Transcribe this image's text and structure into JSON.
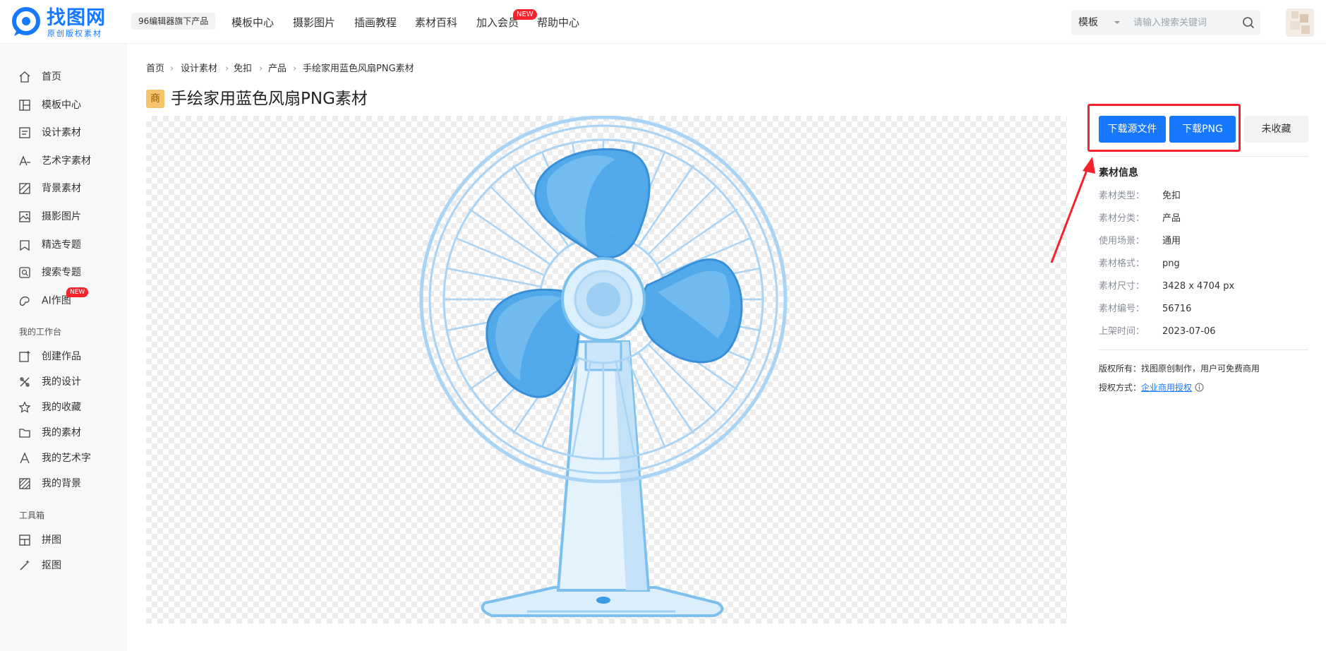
{
  "header": {
    "logo_title": "找图网",
    "logo_sub": "原创版权素材",
    "product_badge": "96编辑器旗下产品",
    "nav": [
      {
        "label": "模板中心"
      },
      {
        "label": "摄影图片"
      },
      {
        "label": "插画教程"
      },
      {
        "label": "素材百科"
      },
      {
        "label": "加入会员",
        "badge": "NEW"
      },
      {
        "label": "帮助中心"
      }
    ],
    "search": {
      "type": "模板",
      "placeholder": "请输入搜索关键词"
    }
  },
  "sidebar": {
    "items": [
      {
        "label": "首页",
        "icon": "home-icon"
      },
      {
        "label": "模板中心",
        "icon": "template-icon"
      },
      {
        "label": "设计素材",
        "icon": "design-material-icon"
      },
      {
        "label": "艺术字素材",
        "icon": "art-text-icon"
      },
      {
        "label": "背景素材",
        "icon": "background-icon"
      },
      {
        "label": "摄影图片",
        "icon": "photo-icon"
      },
      {
        "label": "精选专题",
        "icon": "featured-topic-icon"
      },
      {
        "label": "搜索专题",
        "icon": "search-topic-icon"
      },
      {
        "label": "AI作图",
        "icon": "ai-paint-icon",
        "badge": "NEW"
      }
    ],
    "workspace_title": "我的工作台",
    "workspace": [
      {
        "label": "创建作品",
        "icon": "create-work-icon"
      },
      {
        "label": "我的设计",
        "icon": "my-design-icon"
      },
      {
        "label": "我的收藏",
        "icon": "star-icon"
      },
      {
        "label": "我的素材",
        "icon": "folder-icon"
      },
      {
        "label": "我的艺术字",
        "icon": "letter-a-icon"
      },
      {
        "label": "我的背景",
        "icon": "pattern-icon"
      }
    ],
    "tools_title": "工具箱",
    "tools": [
      {
        "label": "拼图",
        "icon": "collage-icon"
      },
      {
        "label": "抠图",
        "icon": "magic-wand-icon"
      }
    ]
  },
  "breadcrumb": [
    "首页",
    "设计素材",
    "免扣",
    "产品",
    "手绘家用蓝色风扇PNG素材"
  ],
  "page": {
    "tag": "商",
    "title": "手绘家用蓝色风扇PNG素材"
  },
  "actions": {
    "download_source": "下载源文件",
    "download_png": "下载PNG",
    "favorite": "未收藏"
  },
  "info": {
    "title": "素材信息",
    "rows": [
      {
        "label": "素材类型：",
        "value": "免扣"
      },
      {
        "label": "素材分类：",
        "value": "产品"
      },
      {
        "label": "使用场景：",
        "value": "通用"
      },
      {
        "label": "素材格式：",
        "value": "png"
      },
      {
        "label": "素材尺寸：",
        "value": "3428 x 4704 px"
      },
      {
        "label": "素材编号：",
        "value": "56716"
      },
      {
        "label": "上架时间：",
        "value": "2023-07-06"
      }
    ],
    "copyright": "版权所有：找图原创制作，用户可免费商用",
    "license_label": "授权方式：",
    "license_link": "企业商用授权"
  },
  "colors": {
    "primary": "#1677ff",
    "highlight": "#f5222d",
    "fan_light": "#a9d4f5",
    "fan_dark": "#3b9be6"
  }
}
